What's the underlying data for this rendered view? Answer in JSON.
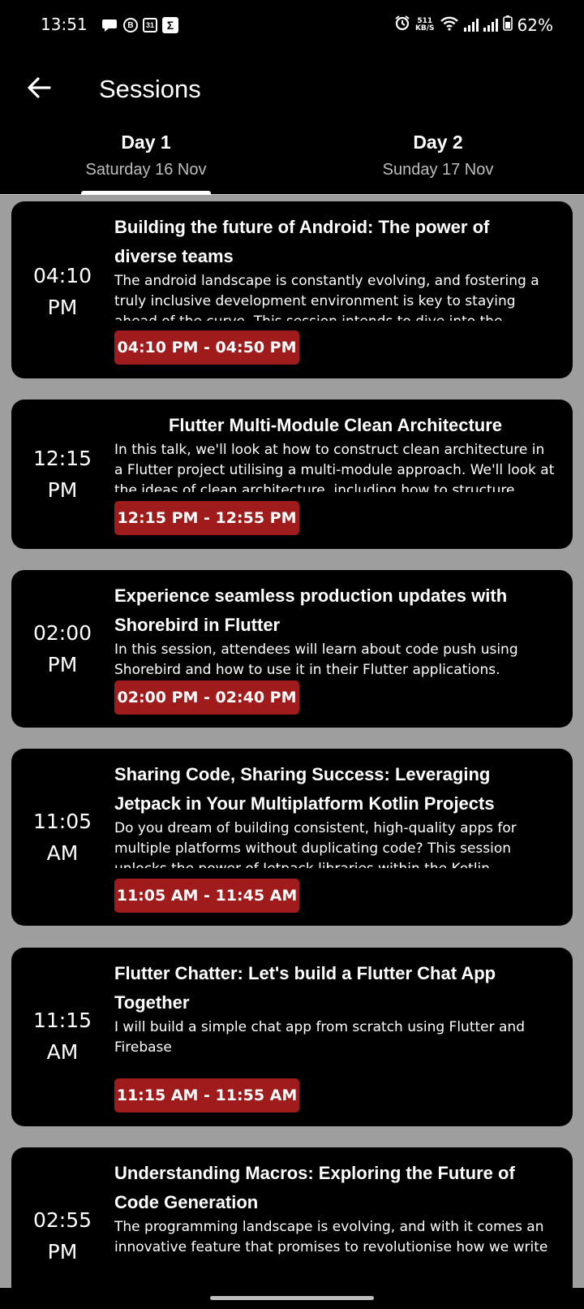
{
  "status_bar": {
    "time": "13:51",
    "left_icons": [
      "chat-bubble-icon",
      "b-circle-icon",
      "calendar-31-icon",
      "sigma-icon"
    ],
    "calendar_day": "31",
    "b_label": "B",
    "sigma_label": "Σ",
    "net_speed_value": "511",
    "net_speed_unit": "KB/S",
    "battery": "62%"
  },
  "app_bar": {
    "title": "Sessions",
    "back_icon": "arrow-left-icon"
  },
  "tabs": [
    {
      "day": "Day 1",
      "date": "Saturday 16 Nov",
      "selected": true
    },
    {
      "day": "Day 2",
      "date": "Sunday 17 Nov",
      "selected": false
    }
  ],
  "colors": {
    "background": "#000000",
    "content_bg": "#9e9e9e",
    "badge": "#a01b1b"
  },
  "sessions": [
    {
      "start_time": "04:10",
      "start_period": "PM",
      "title": "Building the future of Android: The power of diverse teams",
      "description": "The android landscape is constantly evolving, and fostering a truly inclusive development environment is key to staying ahead of the curve. This session  intends to dive into the",
      "time_range": "04:10 PM - 04:50 PM"
    },
    {
      "start_time": "12:15",
      "start_period": "PM",
      "title": "Flutter Multi-Module Clean Architecture",
      "description": "In this talk, we'll look at how to construct clean architecture in a Flutter project utilising a multi-module approach. We'll look at the ideas of clean architecture, including how to structure",
      "time_range": "12:15 PM - 12:55 PM"
    },
    {
      "start_time": "02:00",
      "start_period": "PM",
      "title": "Experience seamless production updates with Shorebird in Flutter",
      "description": "In this session, attendees will learn about code push using Shorebird and how to use it in their Flutter applications.",
      "time_range": "02:00 PM - 02:40 PM"
    },
    {
      "start_time": "11:05",
      "start_period": "AM",
      "title": "Sharing Code, Sharing Success: Leveraging Jetpack in Your Multiplatform Kotlin Projects",
      "description": "Do you dream of building consistent, high-quality apps for multiple platforms without duplicating code? This session unlocks the power of Jetpack libraries within the Kotlin",
      "time_range": "11:05 AM - 11:45 AM"
    },
    {
      "start_time": "11:15",
      "start_period": "AM",
      "title": "Flutter Chatter: Let's build a Flutter Chat App Together",
      "description": "I will build a simple chat app from scratch using Flutter and Firebase",
      "time_range": "11:15 AM - 11:55 AM"
    },
    {
      "start_time": "02:55",
      "start_period": "PM",
      "title": "Understanding Macros: Exploring the Future of Code Generation",
      "description": "The programming landscape is evolving, and with it comes an innovative feature that promises to revolutionise how we write",
      "time_range": ""
    }
  ]
}
